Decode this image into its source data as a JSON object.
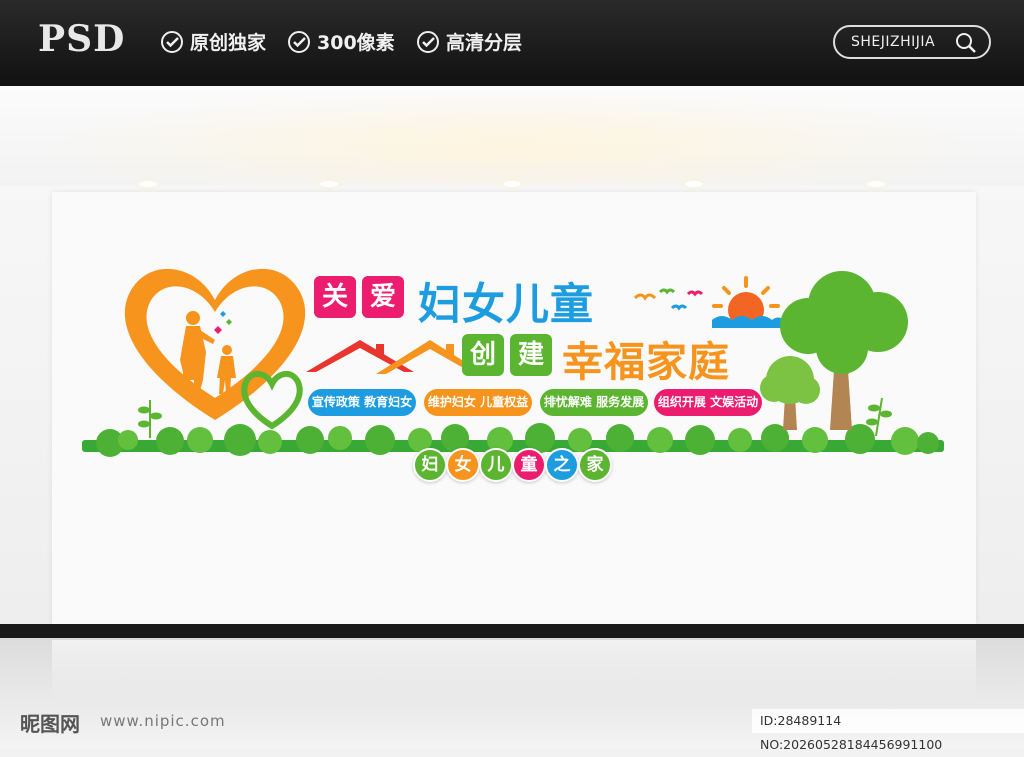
{
  "topbar": {
    "logo": "PSD",
    "features": [
      "原创独家",
      "300像素",
      "高清分层"
    ],
    "search_text": "SHEJIZHIJIA"
  },
  "sign": {
    "title_boxes": [
      "关",
      "爱"
    ],
    "title_main": "妇女儿童",
    "sub_boxes": [
      "创",
      "建"
    ],
    "sub_main": "幸福家庭",
    "pills": [
      "宣传政策 教育妇女",
      "维护妇女 儿童权益",
      "排忧解难 服务发展",
      "组织开展 文娱活动"
    ],
    "circles": [
      "妇",
      "女",
      "儿",
      "童",
      "之",
      "家"
    ]
  },
  "colors": {
    "orange": "#f7941d",
    "pink": "#ec1c6e",
    "blue": "#1d9de0",
    "green": "#5cb531",
    "dark_green": "#39a935"
  },
  "watermark": {
    "site_logo": "昵图网",
    "site_url": "www.nipic.com",
    "id_text": "ID:28489114 NO:20260528184456991100"
  }
}
